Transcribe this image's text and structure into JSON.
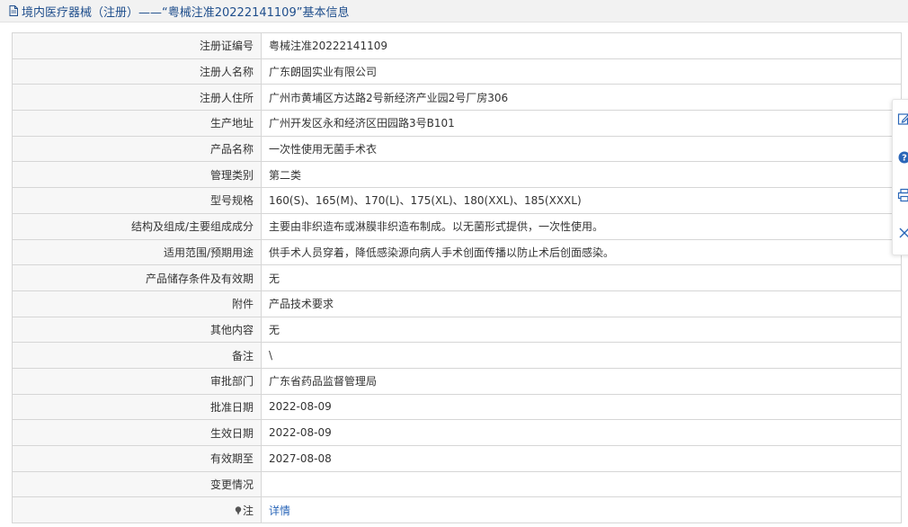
{
  "header": {
    "title": "境内医疗器械（注册）——“粤械注准20222141109”基本信息"
  },
  "rows": [
    {
      "label": "注册证编号",
      "value": "粤械注准20222141109"
    },
    {
      "label": "注册人名称",
      "value": "广东朗固实业有限公司"
    },
    {
      "label": "注册人住所",
      "value": "广州市黄埔区方达路2号新经济产业园2号厂房306"
    },
    {
      "label": "生产地址",
      "value": "广州开发区永和经济区田园路3号B101"
    },
    {
      "label": "产品名称",
      "value": "一次性使用无菌手术衣"
    },
    {
      "label": "管理类别",
      "value": "第二类"
    },
    {
      "label": "型号规格",
      "value": "160(S)、165(M)、170(L)、175(XL)、180(XXL)、185(XXXL)"
    },
    {
      "label": "结构及组成/主要组成成分",
      "value": "主要由非织造布或淋膜非织造布制成。以无菌形式提供，一次性使用。"
    },
    {
      "label": "适用范围/预期用途",
      "value": "供手术人员穿着，降低感染源向病人手术创面传播以防止术后创面感染。"
    },
    {
      "label": "产品储存条件及有效期",
      "value": "无"
    },
    {
      "label": "附件",
      "value": "产品技术要求"
    },
    {
      "label": "其他内容",
      "value": "无"
    },
    {
      "label": "备注",
      "value": "\\"
    },
    {
      "label": "审批部门",
      "value": "广东省药品监督管理局"
    },
    {
      "label": "批准日期",
      "value": "2022-08-09"
    },
    {
      "label": "生效日期",
      "value": "2022-08-09"
    },
    {
      "label": "有效期至",
      "value": "2027-08-08"
    },
    {
      "label": "变更情况",
      "value": ""
    }
  ],
  "note_row": {
    "label": "注",
    "link_text": "详情"
  },
  "icons": {
    "header": "document-icon",
    "note": "pin-icon",
    "sidebar": [
      "edit-icon",
      "help-icon",
      "print-icon",
      "close-icon"
    ]
  },
  "colors": {
    "title": "#1f4e8c",
    "link": "#2a66b8",
    "accent": "#2a66b8"
  }
}
